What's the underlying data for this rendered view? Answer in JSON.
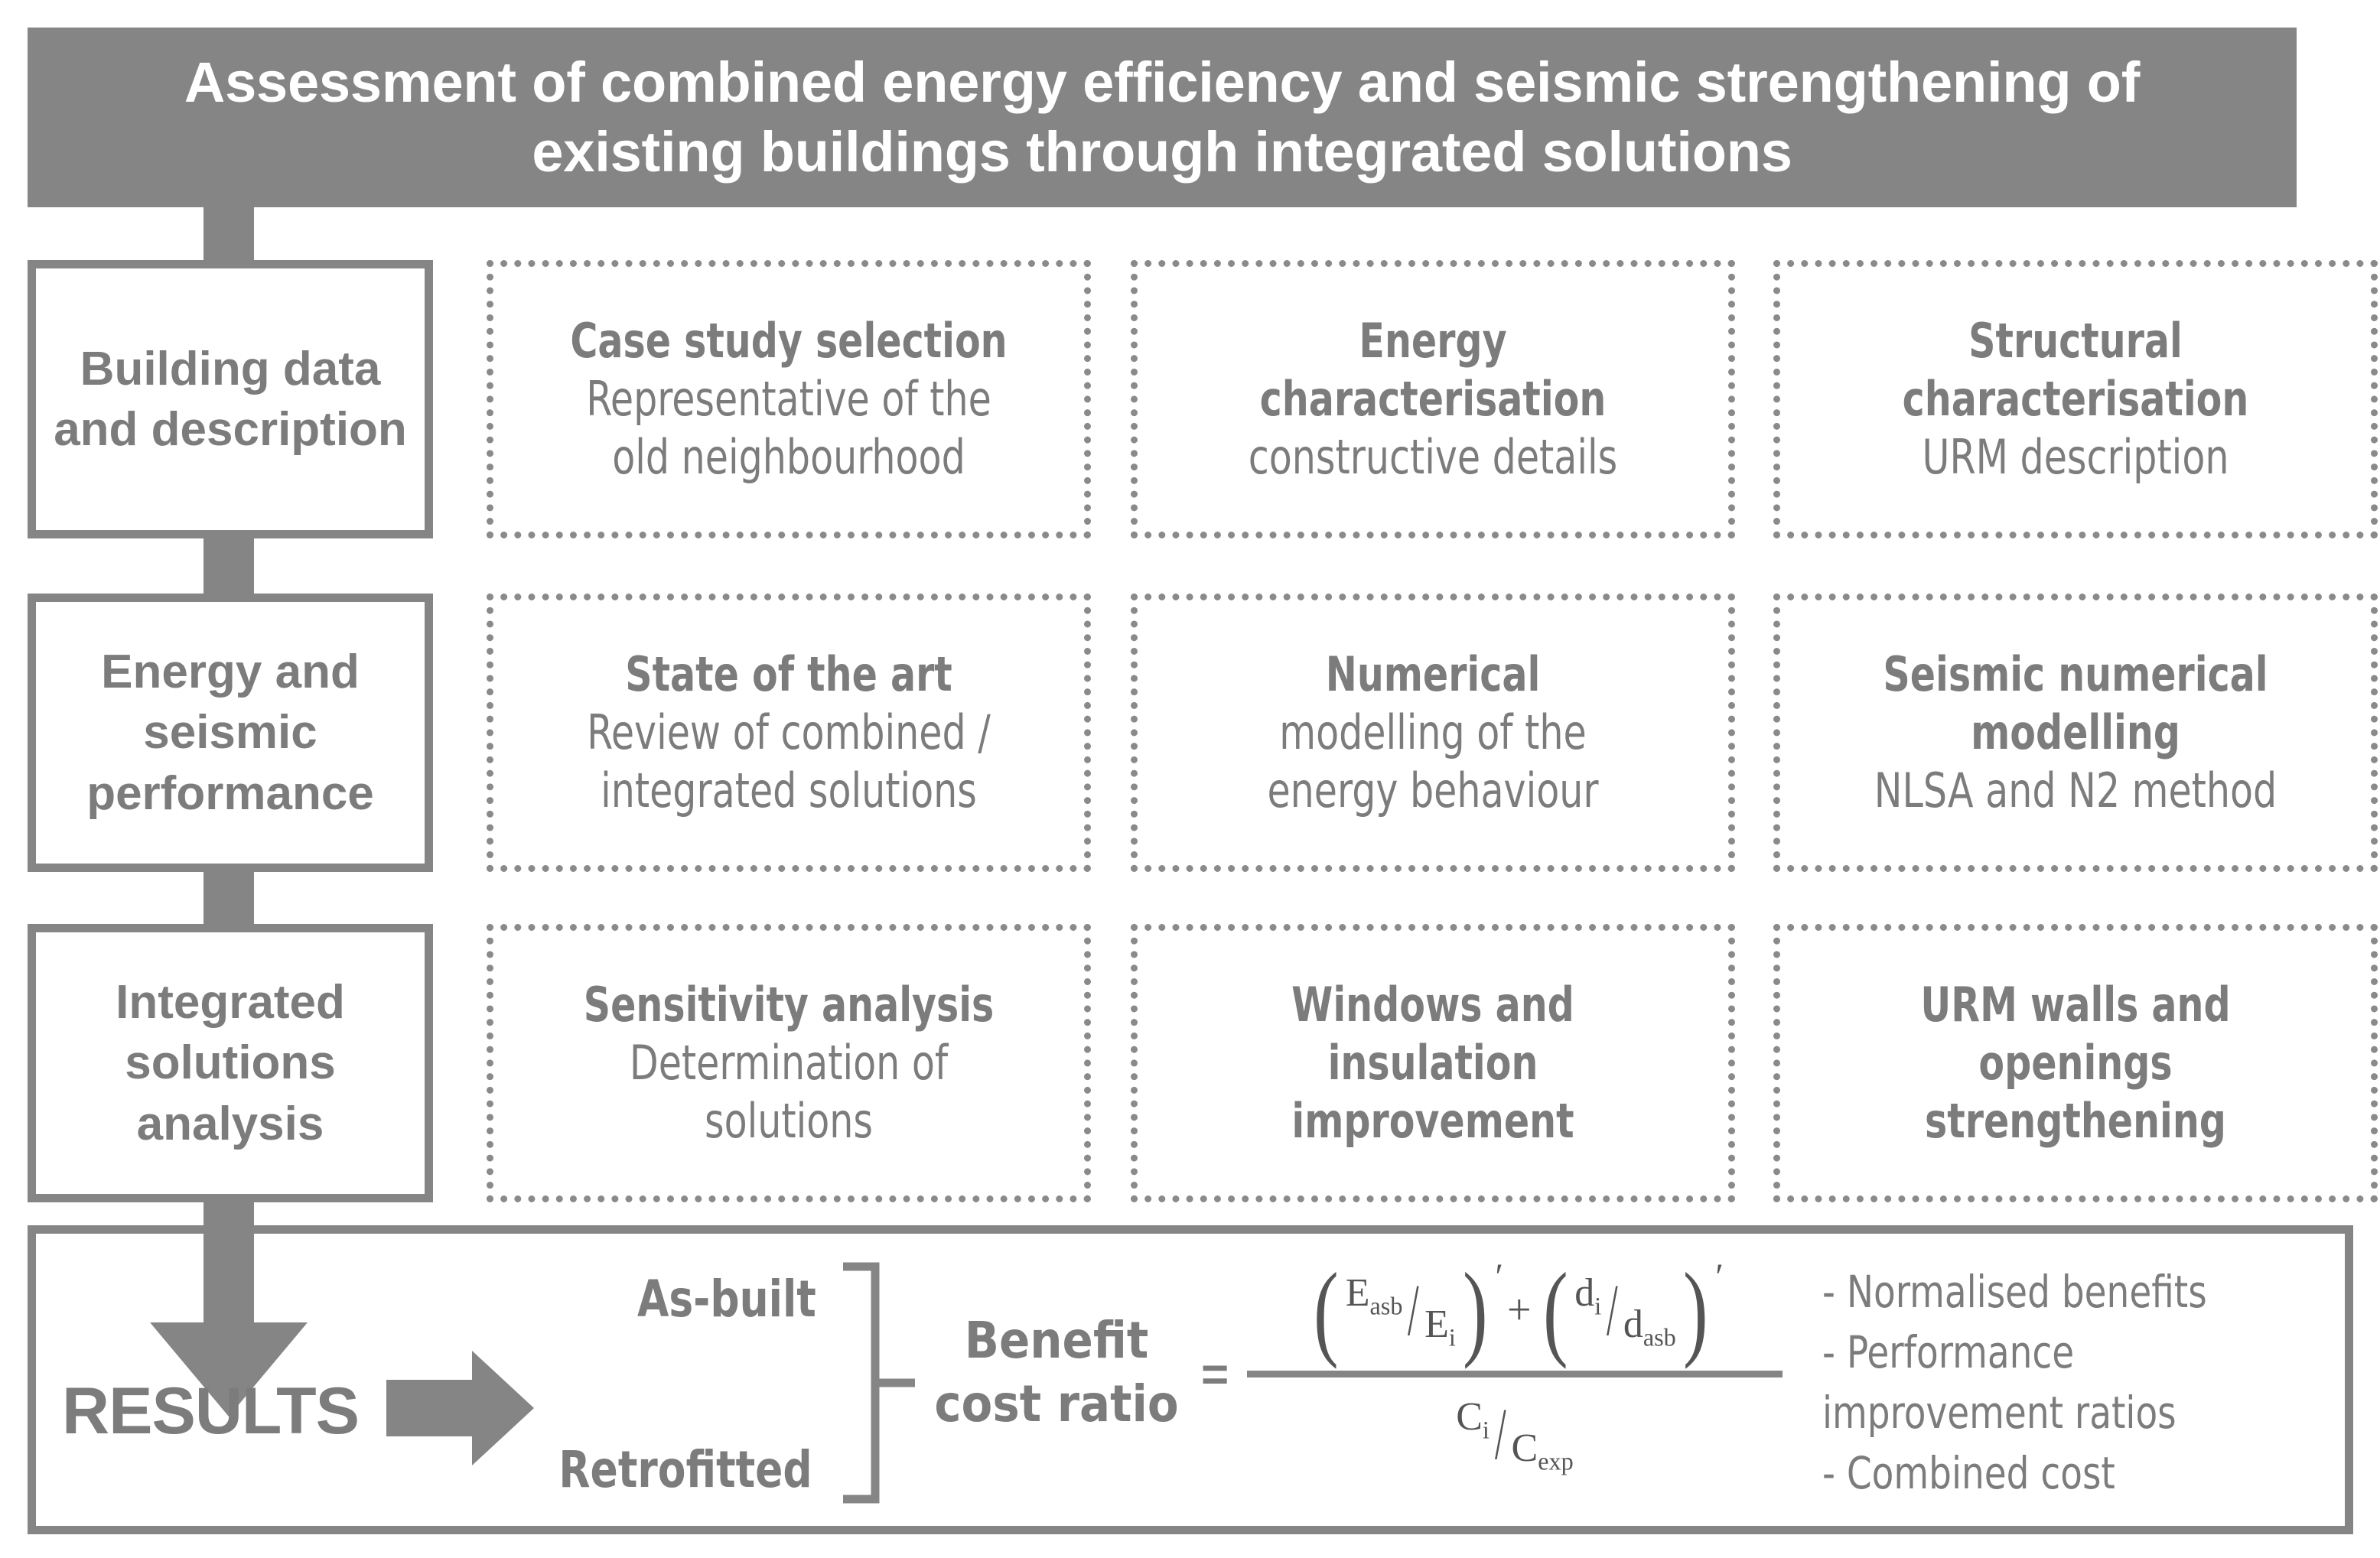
{
  "title": {
    "text": "Assessment of combined energy efficiency and seismic strengthening of existing buildings through integrated solutions"
  },
  "colors": {
    "banner_fill": "#858585",
    "banner_text": "#ffffff",
    "body_text": "#7c7c7c",
    "border": "#858585",
    "dotted_border": "#8a8a8a",
    "background": "#ffffff"
  },
  "stages": [
    {
      "label": "Building data and description"
    },
    {
      "label": "Energy and seismic performance"
    },
    {
      "label": "Integrated solutions analysis"
    }
  ],
  "rows": [
    {
      "cards": [
        {
          "lines": [
            {
              "text": "Case study selection",
              "bold": true
            },
            {
              "text": "Representative of the",
              "bold": false
            },
            {
              "text": "old neighbourhood",
              "bold": false
            }
          ]
        },
        {
          "lines": [
            {
              "text": "Energy",
              "bold": true
            },
            {
              "text": "characterisation",
              "bold": true
            },
            {
              "text": "constructive details",
              "bold": false
            }
          ]
        },
        {
          "lines": [
            {
              "text": "Structural",
              "bold": true
            },
            {
              "text": "characterisation",
              "bold": true
            },
            {
              "text": "URM description",
              "bold": false
            }
          ]
        }
      ]
    },
    {
      "cards": [
        {
          "lines": [
            {
              "text": "State of the art",
              "bold": true
            },
            {
              "text": "Review of combined /",
              "bold": false
            },
            {
              "text": "integrated solutions",
              "bold": false
            }
          ]
        },
        {
          "lines": [
            {
              "text": "Numerical",
              "bold": true
            },
            {
              "text": "modelling of the",
              "bold": false
            },
            {
              "text": "energy behaviour",
              "bold": false
            }
          ]
        },
        {
          "lines": [
            {
              "text": "Seismic numerical",
              "bold": true
            },
            {
              "text": "modelling",
              "bold": true
            },
            {
              "text": "NLSA and N2 method",
              "bold": false
            }
          ]
        }
      ]
    },
    {
      "cards": [
        {
          "lines": [
            {
              "text": "Sensitivity analysis",
              "bold": true
            },
            {
              "text": "Determination of",
              "bold": false
            },
            {
              "text": "solutions",
              "bold": false
            }
          ]
        },
        {
          "lines": [
            {
              "text": "Windows and",
              "bold": true
            },
            {
              "text": "insulation",
              "bold": true
            },
            {
              "text": "improvement",
              "bold": true
            }
          ]
        },
        {
          "lines": [
            {
              "text": "URM walls and",
              "bold": true
            },
            {
              "text": "openings",
              "bold": true
            },
            {
              "text": "strengthening",
              "bold": true
            }
          ]
        }
      ]
    }
  ],
  "results": {
    "heading": "RESULTS",
    "cases": [
      "As-built",
      "Retrofitted"
    ],
    "benefit_label_line1": "Benefit",
    "benefit_label_line2": "cost ratio",
    "equals": "=",
    "formula": {
      "numerator_term1_num": "E",
      "numerator_term1_num_sub": "asb",
      "numerator_term1_den": "E",
      "numerator_term1_den_sub": "i",
      "numerator_term1_prime": "′",
      "operator": "+",
      "numerator_term2_num": "d",
      "numerator_term2_num_sub": "i",
      "numerator_term2_den": "d",
      "numerator_term2_den_sub": "asb",
      "numerator_term2_prime": "′",
      "denominator_num": "C",
      "denominator_num_sub": "i",
      "denominator_den": "C",
      "denominator_den_sub": "exp"
    },
    "bullets": [
      "- Normalised benefits",
      "- Performance",
      "improvement ratios",
      "- Combined cost"
    ]
  },
  "icons": {
    "down_arrow": "down-arrow-icon",
    "right_arrow": "right-arrow-icon",
    "brace": "brace-icon"
  }
}
